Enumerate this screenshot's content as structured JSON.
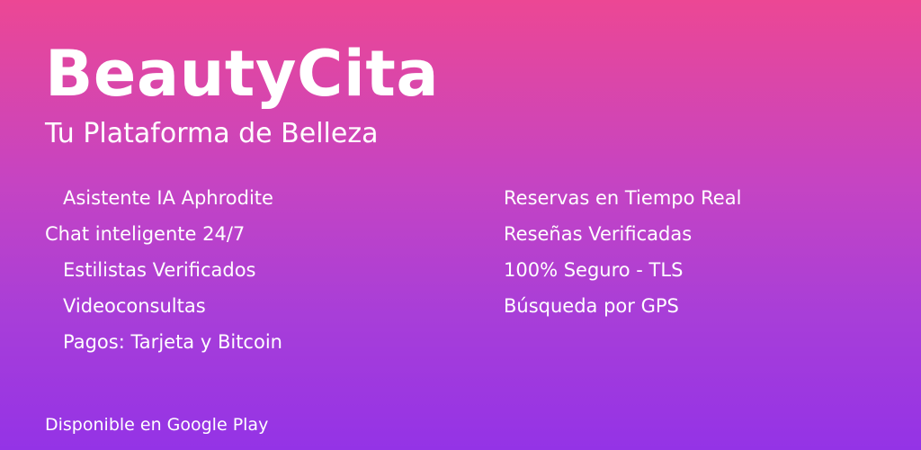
{
  "brand": {
    "title": "BeautyCita",
    "subtitle": "Tu Plataforma de Belleza"
  },
  "features_left": [
    "Asistente IA Aphrodite",
    "Chat inteligente 24/7",
    "Estilistas Verificados",
    "Videoconsultas",
    "Pagos: Tarjeta y Bitcoin"
  ],
  "features_right": [
    "Reservas en Tiempo Real",
    "Reseñas Verificadas",
    "100% Seguro - TLS",
    "Búsqueda por GPS"
  ],
  "footer": {
    "availability": "Disponible en Google Play"
  },
  "colors": {
    "gradient_top": "#ec4794",
    "gradient_bottom": "#9433e6",
    "text": "#ffffff"
  }
}
